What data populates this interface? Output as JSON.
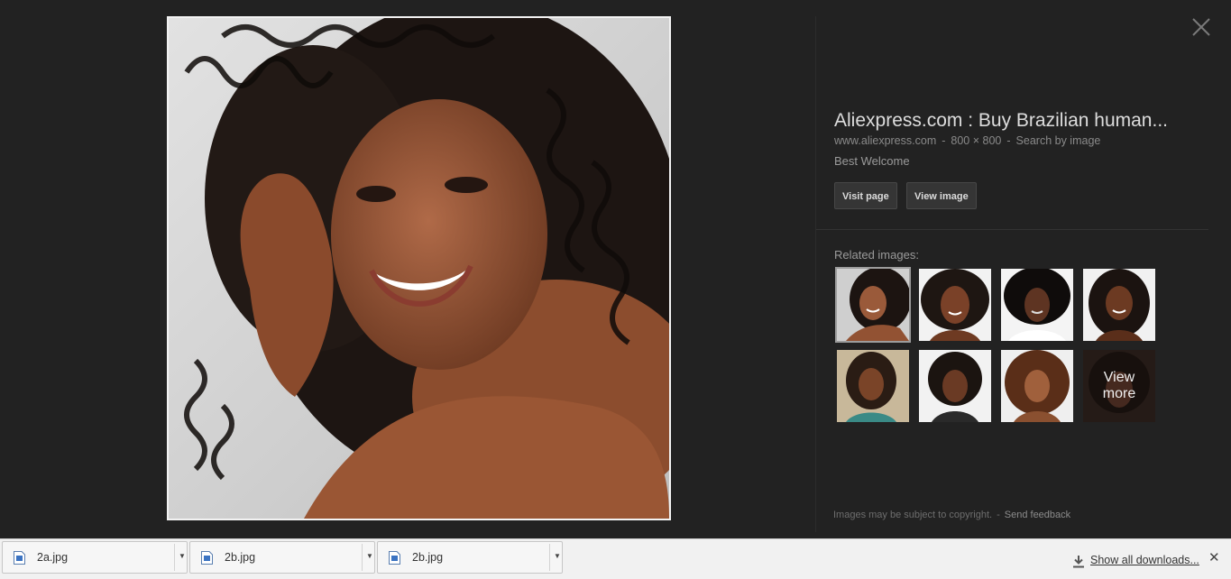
{
  "viewer": {
    "title": "Aliexpress.com : Buy Brazilian human...",
    "source_domain": "www.aliexpress.com",
    "dimensions": "800 × 800",
    "search_by_image_label": "Search by image",
    "description": "Best Welcome",
    "visit_page_label": "Visit page",
    "view_image_label": "View image",
    "related_label": "Related images:",
    "view_more_label": "View\nmore",
    "copyright_notice": "Images may be subject to copyright.",
    "feedback_label": "Send feedback",
    "close_icon": "close-icon"
  },
  "downloads": {
    "items": [
      {
        "name": "2a.jpg"
      },
      {
        "name": "2b.jpg"
      },
      {
        "name": "2b.jpg"
      }
    ],
    "show_all_label": "Show all downloads...",
    "close_glyph": "✕"
  },
  "colors": {
    "viewer_bg": "#222222",
    "shelf_bg": "#f1f1f1",
    "button_bg": "#353535"
  }
}
